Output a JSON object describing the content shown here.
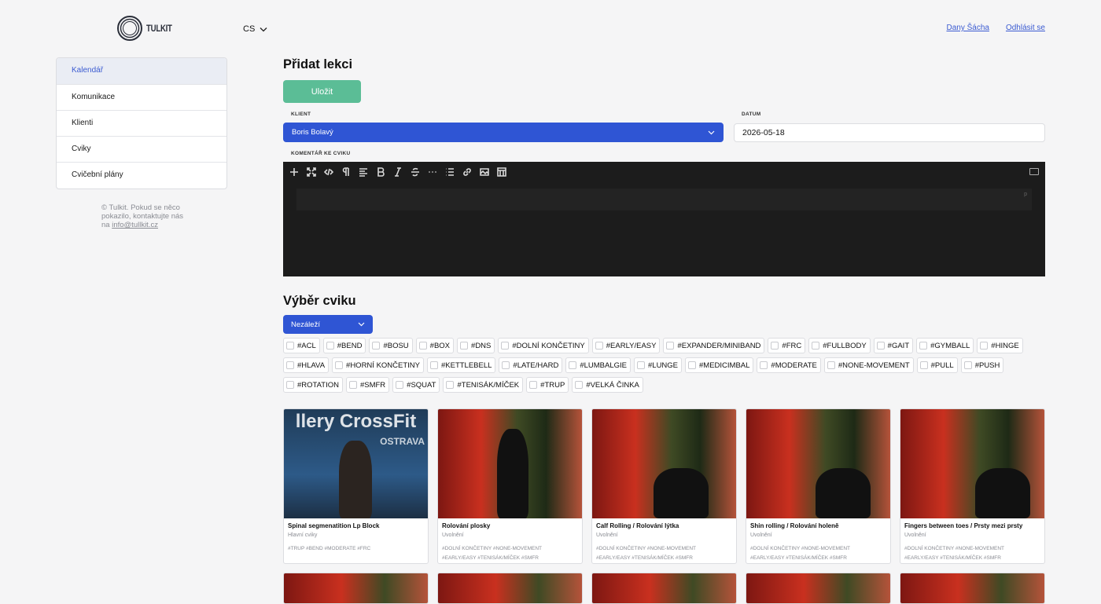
{
  "header": {
    "logo_text": "TULKIT",
    "lang": "CS",
    "user_name": "Dany Šácha",
    "logout": "Odhlásit se"
  },
  "sidebar": {
    "items": [
      {
        "label": "Kalendář",
        "active": true
      },
      {
        "label": "Komunikace"
      },
      {
        "label": "Klienti"
      },
      {
        "label": "Cviky"
      },
      {
        "label": "Cvičební plány"
      }
    ],
    "footer_text": "© Tulkit. Pokud se něco pokazilo, kontaktujte nás na",
    "footer_email": "info@tullkit.cz"
  },
  "form": {
    "title": "Přidat lekci",
    "save_label": "Uložit",
    "client_label": "KLIENT",
    "client_value": "Boris Bolavý",
    "date_label": "DATUM",
    "date_value": "2026-05-18",
    "comment_label": "KOMENTÁŘ KE CVIKU",
    "editor_block": "p"
  },
  "exercise": {
    "title": "Výběr cviku",
    "filter_value": "Nezáleží",
    "tags": [
      "#ACL",
      "#BEND",
      "#BOSU",
      "#BOX",
      "#DNS",
      "#DOLNÍ KONČETINY",
      "#EARLY/EASY",
      "#EXPANDER/MINIBAND",
      "#FRC",
      "#FULLBODY",
      "#GAIT",
      "#GYMBALL",
      "#HINGE",
      "#HLAVA",
      "#HORNÍ KONČETINY",
      "#KETTLEBELL",
      "#LATE/HARD",
      "#LUMBALGIE",
      "#LUNGE",
      "#MEDICIMBAL",
      "#MODERATE",
      "#NONE-MOVEMENT",
      "#PULL",
      "#PUSH",
      "#ROTATION",
      "#SMFR",
      "#SQUAT",
      "#TENISÁK/MÍČEK",
      "#TRUP",
      "#VELKÁ ČINKA"
    ],
    "cards": [
      {
        "title": "Spinal segmenatition Lp Block",
        "category": "Hlavní cviky",
        "tags1": "#TRUP #BEND #MODERATE #FRC",
        "tags2": "",
        "thumb": "blue",
        "photo_text": "llery CrossFit",
        "photo_sub": "OSTRAVA"
      },
      {
        "title": "Rolování plosky",
        "category": "Uvolnění",
        "tags1": "#DOLNÍ KONČETINY #NONE-MOVEMENT",
        "tags2": "#EARLY/EASY #TENISÁK/MÍČEK #SMFR",
        "thumb": "red",
        "photo_text": "",
        "photo_sub": ""
      },
      {
        "title": "Calf Rolling / Rolování lýtka",
        "category": "Uvolnění",
        "tags1": "#DOLNÍ KONČETINY #NONE-MOVEMENT",
        "tags2": "#EARLY/EASY #TENISÁK/MÍČEK #SMFR",
        "thumb": "red",
        "photo_text": "",
        "photo_sub": ""
      },
      {
        "title": "Shin rolling / Rolování holeně",
        "category": "Uvolnění",
        "tags1": "#DOLNÍ KONČETINY #NONE-MOVEMENT",
        "tags2": "#EARLY/EASY #TENISÁK/MÍČEK #SMFR",
        "thumb": "red",
        "photo_text": "",
        "photo_sub": ""
      },
      {
        "title": "Fingers between toes / Prsty mezi prsty",
        "category": "Uvolnění",
        "tags1": "#DOLNÍ KONČETINY #NONE-MOVEMENT",
        "tags2": "#EARLY/EASY #TENISÁK/MÍČEK #SMFR",
        "thumb": "red",
        "photo_text": "",
        "photo_sub": ""
      }
    ]
  }
}
